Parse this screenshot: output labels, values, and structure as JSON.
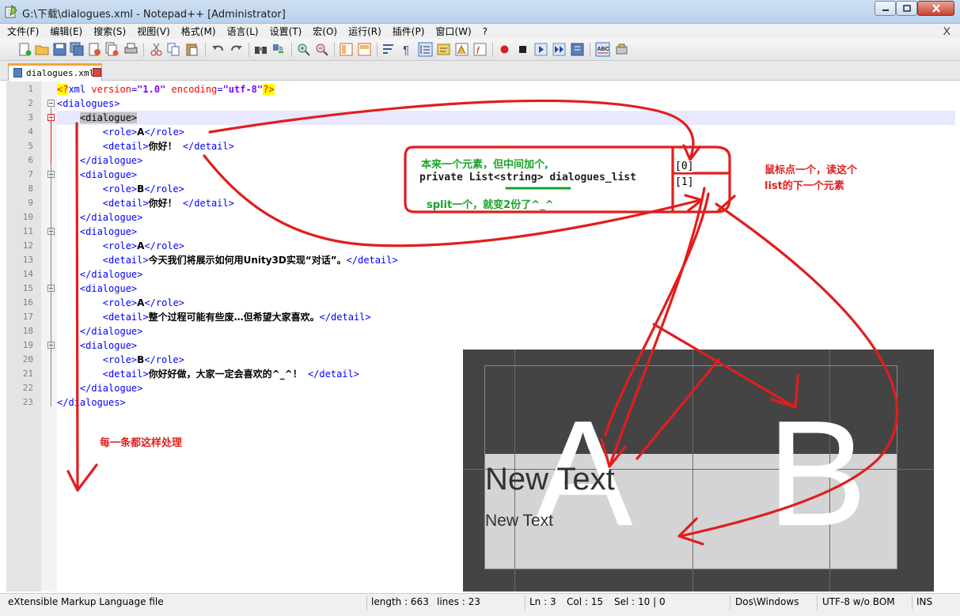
{
  "window": {
    "title": "G:\\下载\\dialogues.xml - Notepad++ [Administrator]"
  },
  "menu": [
    "文件(F)",
    "编辑(E)",
    "搜索(S)",
    "视图(V)",
    "格式(M)",
    "语言(L)",
    "设置(T)",
    "宏(O)",
    "运行(R)",
    "插件(P)",
    "窗口(W)",
    "?"
  ],
  "menu_close": "X",
  "tab": {
    "label": "dialogues.xml"
  },
  "code": [
    {
      "n": "1",
      "tokens": [
        [
          "pi",
          "<?"
        ],
        [
          "br",
          "xml"
        ],
        [
          "at",
          " version"
        ],
        [
          "br",
          "="
        ],
        [
          "av",
          "\"1.0\""
        ],
        [
          "at",
          " encoding"
        ],
        [
          "br",
          "="
        ],
        [
          "av",
          "\"utf-8\""
        ],
        [
          "pi",
          "?>"
        ]
      ]
    },
    {
      "n": "2",
      "tokens": [
        [
          "br",
          "<dialogues>"
        ]
      ]
    },
    {
      "n": "3",
      "tokens": [
        [
          "dots",
          "    "
        ],
        [
          "sel",
          "<dialogue>"
        ]
      ]
    },
    {
      "n": "4",
      "tokens": [
        [
          "dots",
          "        "
        ],
        [
          "br",
          "<role>"
        ],
        [
          "txt",
          "A"
        ],
        [
          "br",
          "</role>"
        ]
      ]
    },
    {
      "n": "5",
      "tokens": [
        [
          "dots",
          "        "
        ],
        [
          "br",
          "<detail>"
        ],
        [
          "txt",
          "你好！"
        ],
        [
          "br",
          " </detail>"
        ]
      ]
    },
    {
      "n": "6",
      "tokens": [
        [
          "dots",
          "    "
        ],
        [
          "br",
          "</dialogue>"
        ]
      ]
    },
    {
      "n": "7",
      "tokens": [
        [
          "dots",
          "    "
        ],
        [
          "br",
          "<dialogue>"
        ]
      ]
    },
    {
      "n": "8",
      "tokens": [
        [
          "dots",
          "        "
        ],
        [
          "br",
          "<role>"
        ],
        [
          "txt",
          "B"
        ],
        [
          "br",
          "</role>"
        ]
      ]
    },
    {
      "n": "9",
      "tokens": [
        [
          "dots",
          "        "
        ],
        [
          "br",
          "<detail>"
        ],
        [
          "txt",
          "你好！"
        ],
        [
          "br",
          " </detail>"
        ]
      ]
    },
    {
      "n": "10",
      "tokens": [
        [
          "dots",
          "    "
        ],
        [
          "br",
          "</dialogue>"
        ]
      ]
    },
    {
      "n": "11",
      "tokens": [
        [
          "dots",
          "    "
        ],
        [
          "br",
          "<dialogue>"
        ]
      ]
    },
    {
      "n": "12",
      "tokens": [
        [
          "dots",
          "        "
        ],
        [
          "br",
          "<role>"
        ],
        [
          "txt",
          "A"
        ],
        [
          "br",
          "</role>"
        ]
      ]
    },
    {
      "n": "13",
      "tokens": [
        [
          "dots",
          "        "
        ],
        [
          "br",
          "<detail>"
        ],
        [
          "txt",
          "今天我们将展示如何用Unity3D实现“对话”。"
        ],
        [
          "br",
          "</detail>"
        ]
      ]
    },
    {
      "n": "14",
      "tokens": [
        [
          "dots",
          "    "
        ],
        [
          "br",
          "</dialogue>"
        ]
      ]
    },
    {
      "n": "15",
      "tokens": [
        [
          "dots",
          "    "
        ],
        [
          "br",
          "<dialogue>"
        ]
      ]
    },
    {
      "n": "16",
      "tokens": [
        [
          "dots",
          "        "
        ],
        [
          "br",
          "<role>"
        ],
        [
          "txt",
          "A"
        ],
        [
          "br",
          "</role>"
        ]
      ]
    },
    {
      "n": "17",
      "tokens": [
        [
          "dots",
          "        "
        ],
        [
          "br",
          "<detail>"
        ],
        [
          "txt",
          "整个过程可能有些废…但希望大家喜欢。"
        ],
        [
          "br",
          "</detail>"
        ]
      ]
    },
    {
      "n": "18",
      "tokens": [
        [
          "dots",
          "    "
        ],
        [
          "br",
          "</dialogue>"
        ]
      ]
    },
    {
      "n": "19",
      "tokens": [
        [
          "dots",
          "    "
        ],
        [
          "br",
          "<dialogue>"
        ]
      ]
    },
    {
      "n": "20",
      "tokens": [
        [
          "dots",
          "        "
        ],
        [
          "br",
          "<role>"
        ],
        [
          "txt",
          "B"
        ],
        [
          "br",
          "</role>"
        ]
      ]
    },
    {
      "n": "21",
      "tokens": [
        [
          "dots",
          "        "
        ],
        [
          "br",
          "<detail>"
        ],
        [
          "txt",
          "你好好做，大家一定会喜欢的^_^！"
        ],
        [
          "br",
          " </detail>"
        ]
      ]
    },
    {
      "n": "22",
      "tokens": [
        [
          "dots",
          "    "
        ],
        [
          "br",
          "</dialogue>"
        ]
      ]
    },
    {
      "n": "23",
      "tokens": [
        [
          "br",
          "</dialogues>"
        ]
      ]
    }
  ],
  "annotations": {
    "box_line1": "本来一个元素，但中间加个,",
    "box_line2": "private List<string> dialogues_list",
    "box_line3": "split一个，就变2份了^_^",
    "index0": "[0]",
    "index1": "[1]",
    "click_note_line1": "鼠标点一个，读这个",
    "click_note_line2": "list的下一个元素",
    "each_note": "每一条都这样处理"
  },
  "preview": {
    "letter_left": "A",
    "letter_right": "B",
    "text_large": "New Text",
    "text_small": "New Text"
  },
  "status": {
    "filetype": "eXtensible Markup Language file",
    "length": "length : 663",
    "lines": "lines : 23",
    "ln": "Ln : 3",
    "col": "Col : 15",
    "sel": "Sel : 10 | 0",
    "eol": "Dos\\Windows",
    "encoding": "UTF-8 w/o BOM",
    "mode": "INS"
  }
}
